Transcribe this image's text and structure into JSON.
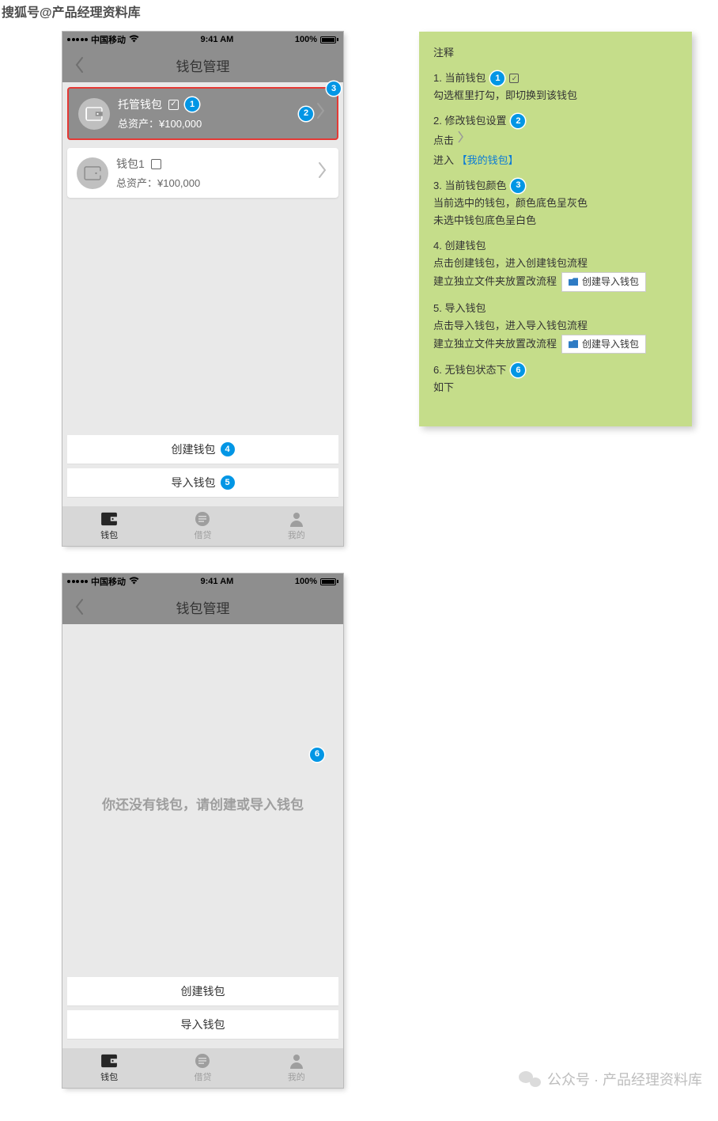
{
  "watermark": {
    "top_left": "搜狐号@产品经理资料库",
    "bottom_right": "公众号 · 产品经理资料库"
  },
  "status_bar": {
    "carrier": "中国移动",
    "time": "9:41 AM",
    "battery": "100%"
  },
  "nav": {
    "title": "钱包管理"
  },
  "wallets": [
    {
      "name": "托管钱包",
      "assets_label": "总资产：",
      "assets_value": "¥100,000",
      "checked": true
    },
    {
      "name": "钱包1",
      "assets_label": "总资产：",
      "assets_value": "¥100,000",
      "checked": false
    }
  ],
  "buttons": {
    "create": "创建钱包",
    "import": "导入钱包"
  },
  "tabs": [
    {
      "label": "钱包",
      "active": true
    },
    {
      "label": "借贷",
      "active": false
    },
    {
      "label": "我的",
      "active": false
    }
  ],
  "empty_state": "你还没有钱包，请创建或导入钱包",
  "badges": {
    "b1": "1",
    "b2": "2",
    "b3": "3",
    "b4": "4",
    "b5": "5",
    "b6": "6"
  },
  "annot": {
    "heading": "注释",
    "n1": {
      "title": "1. 当前钱包",
      "body": "勾选框里打勾，即切换到该钱包"
    },
    "n2": {
      "title": "2. 修改钱包设置",
      "body1": "点击",
      "body2": "进入",
      "link": "【我的钱包】"
    },
    "n3": {
      "title": "3. 当前钱包颜色",
      "line1": "当前选中的钱包，颜色底色呈灰色",
      "line2": "未选中钱包底色呈白色"
    },
    "n4": {
      "title": "4. 创建钱包",
      "line1": "点击创建钱包，进入创建钱包流程",
      "line2": "建立独立文件夹放置改流程",
      "tag": "创建导入钱包"
    },
    "n5": {
      "title": "5. 导入钱包",
      "line1": "点击导入钱包，进入导入钱包流程",
      "line2": "建立独立文件夹放置改流程",
      "tag": "创建导入钱包"
    },
    "n6": {
      "title": "6. 无钱包状态下",
      "body": "如下"
    }
  }
}
